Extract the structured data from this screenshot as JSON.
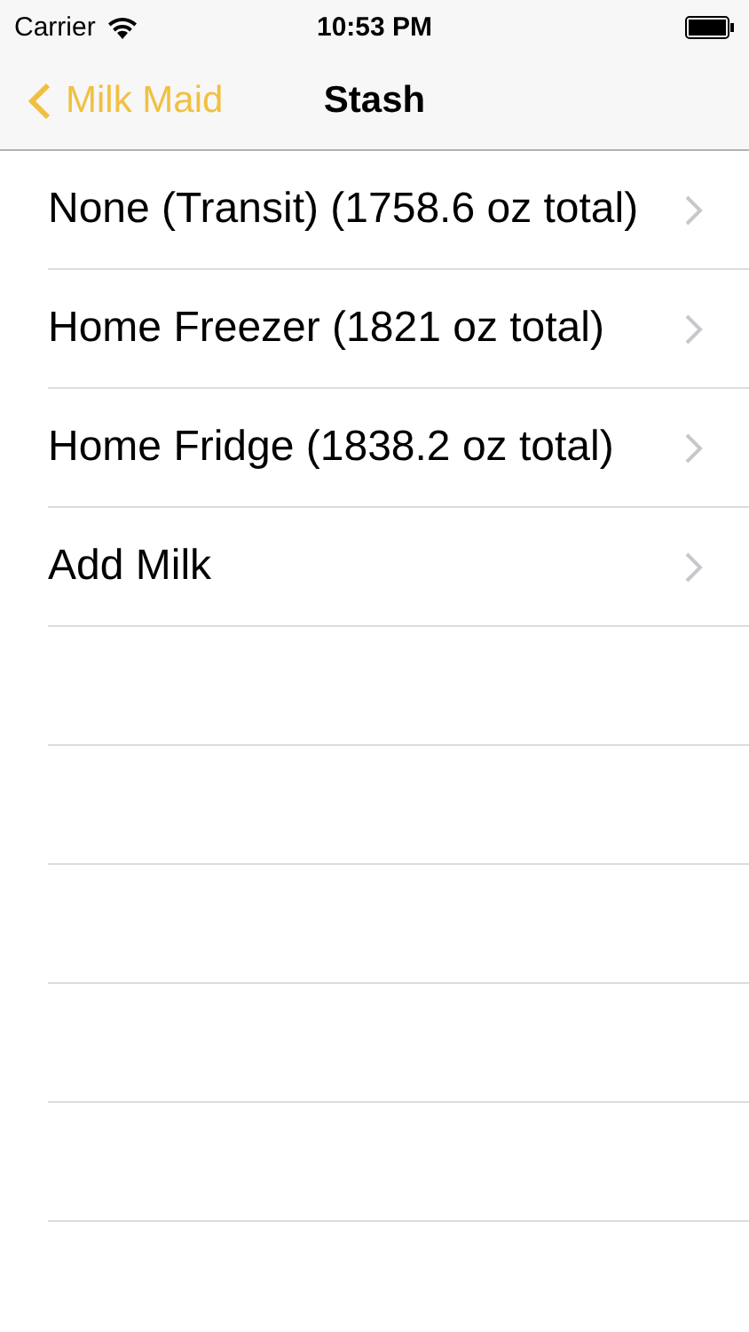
{
  "status_bar": {
    "carrier": "Carrier",
    "time": "10:53 PM"
  },
  "nav_bar": {
    "back_label": "Milk Maid",
    "title": "Stash"
  },
  "rows": [
    {
      "label": "None (Transit) (1758.6 oz total)"
    },
    {
      "label": "Home Freezer (1821 oz total)"
    },
    {
      "label": "Home Fridge (1838.2 oz total)"
    },
    {
      "label": "Add Milk"
    }
  ]
}
